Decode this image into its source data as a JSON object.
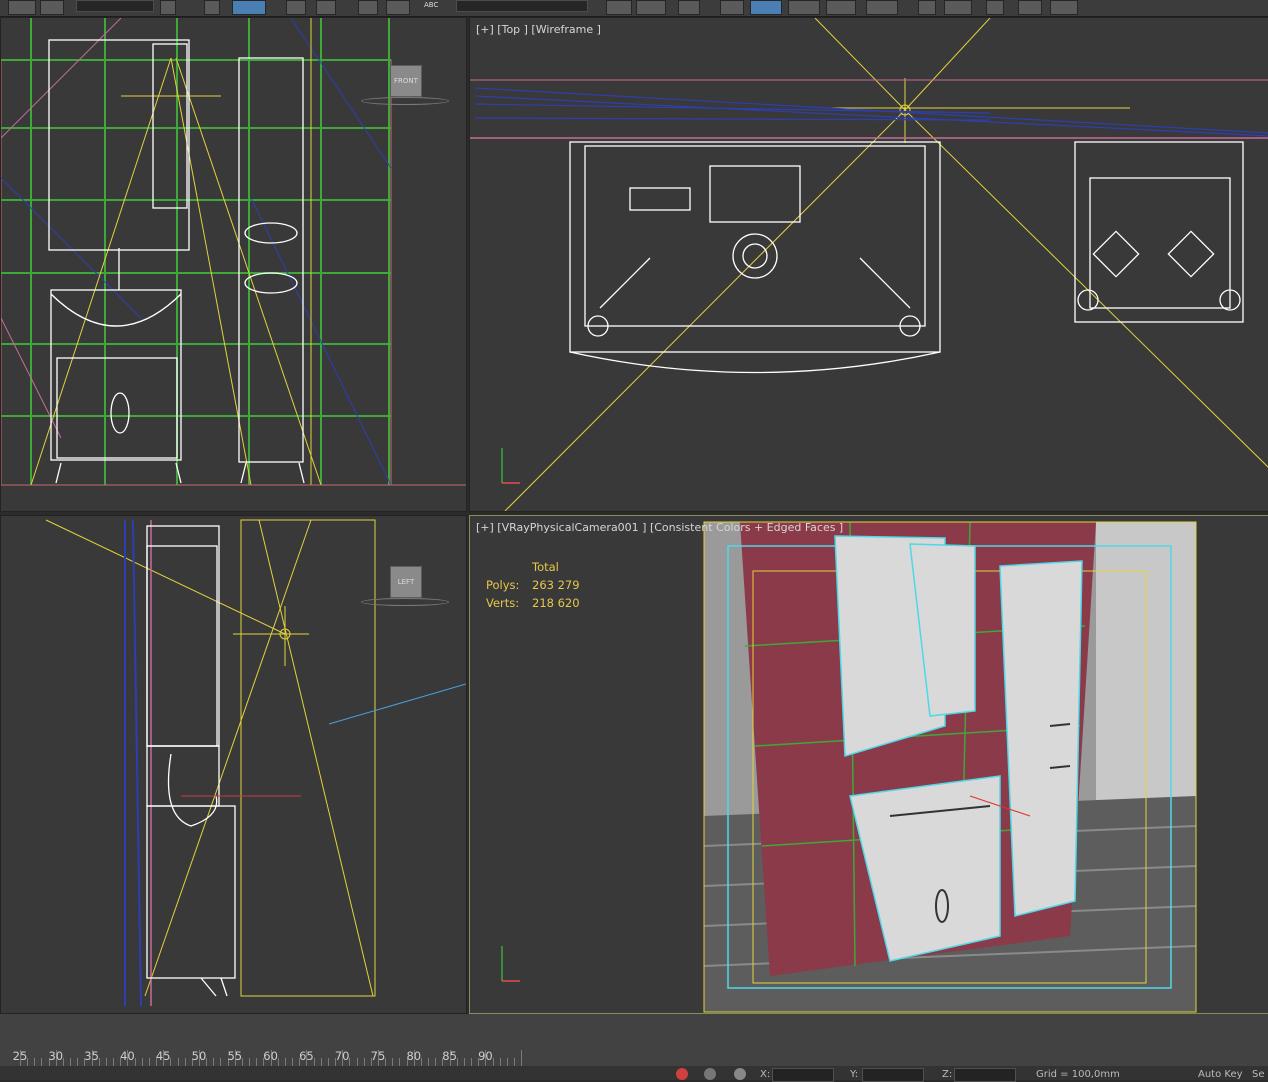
{
  "toolbar": {
    "search_label": "ABC"
  },
  "viewports": {
    "front": {
      "navcube": "FRONT"
    },
    "top": {
      "label": "[+] [Top ] [Wireframe ]"
    },
    "left": {
      "navcube": "LEFT"
    },
    "camera": {
      "label": "[+] [VRayPhysicalCamera001 ] [Consistent Colors + Edged Faces ]",
      "stats": {
        "header": "Total",
        "polys_label": "Polys:",
        "polys_value": "263 279",
        "verts_label": "Verts:",
        "verts_value": "218 620"
      }
    }
  },
  "timeline": {
    "ticks": [
      "25",
      "30",
      "35",
      "40",
      "45",
      "50",
      "55",
      "60",
      "65",
      "70",
      "75",
      "80",
      "85",
      "90"
    ]
  },
  "status_bar": {
    "x_label": "X:",
    "y_label": "Y:",
    "z_label": "Z:",
    "grid": "Grid = 100,0mm",
    "auto_key": "Auto Key",
    "set_key": "Se"
  },
  "colors": {
    "grid_green": "#3fa83a",
    "wall_red": "#8b3a4a",
    "select_cyan": "#4fd8e8",
    "camera_yellow": "#e3d23c",
    "stats_yellow": "#e6c84a"
  }
}
